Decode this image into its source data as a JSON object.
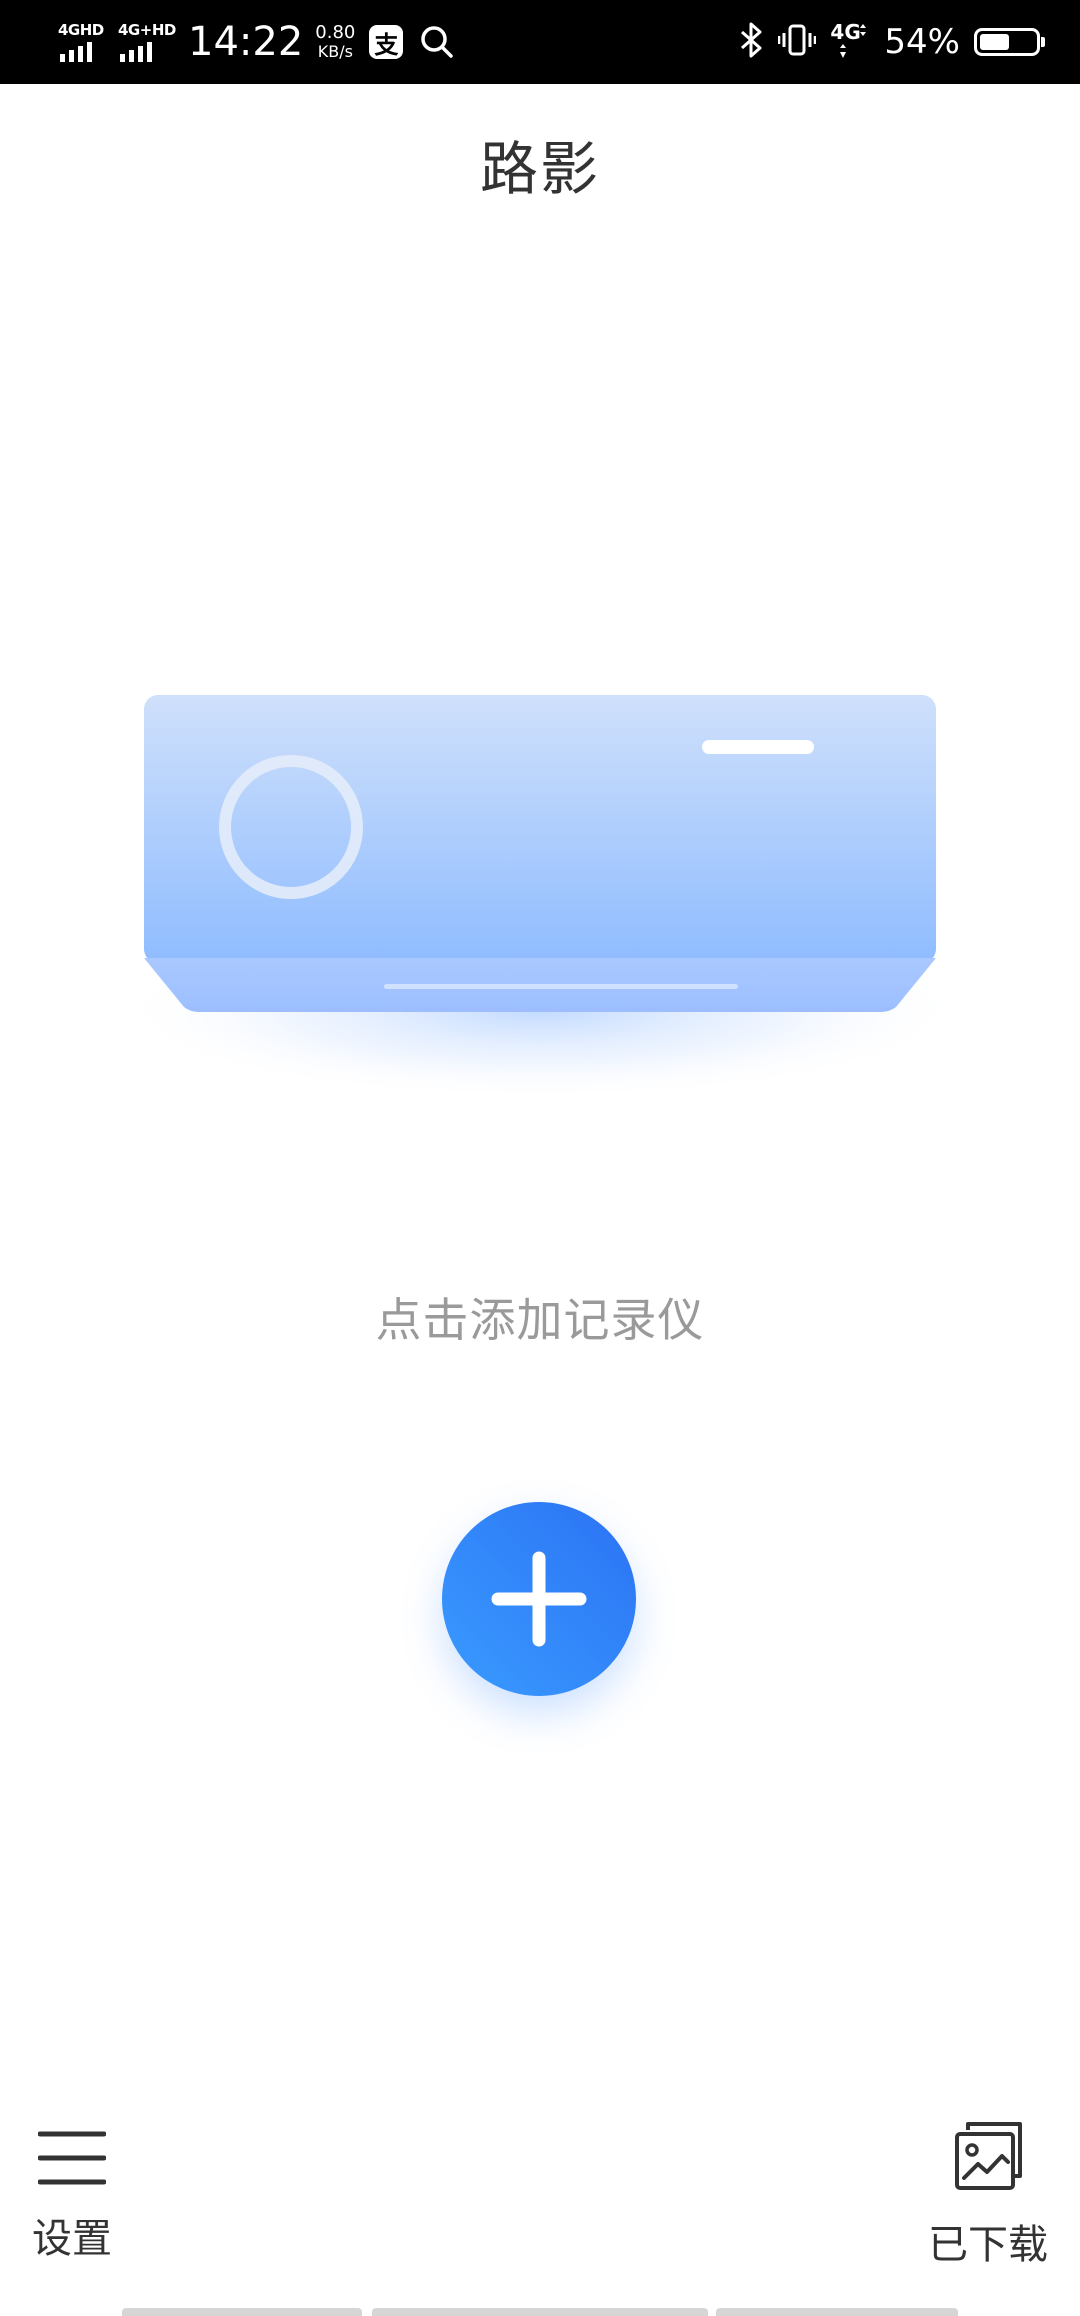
{
  "status_bar": {
    "signal_1_label": "4GHD",
    "signal_2_label": "4G+HD",
    "time": "14:22",
    "speed_value": "0.80",
    "speed_unit": "KB/s",
    "alipay_glyph": "支",
    "network_type": "4G",
    "battery_percent": "54%",
    "battery_level": 0.54,
    "icons": [
      "alipay-icon",
      "search-icon",
      "bluetooth-icon",
      "vibrate-icon",
      "data-4g-icon",
      "battery-icon"
    ]
  },
  "header": {
    "title": "路影"
  },
  "main": {
    "illustration_icon": "dashcam-device-illustration",
    "hint": "点击添加记录仪",
    "add_button_icon": "plus-icon"
  },
  "bottom_nav": {
    "settings_label": "设置",
    "settings_icon": "menu-icon",
    "downloads_label": "已下载",
    "downloads_icon": "gallery-icon"
  },
  "colors": {
    "accent_blue": "#2b72f4",
    "accent_blue_light": "#3a9bff",
    "device_top": "#cfe0fb",
    "device_bottom": "#8fbcff",
    "title_text": "#333333",
    "hint_text": "#9a9a9a"
  }
}
